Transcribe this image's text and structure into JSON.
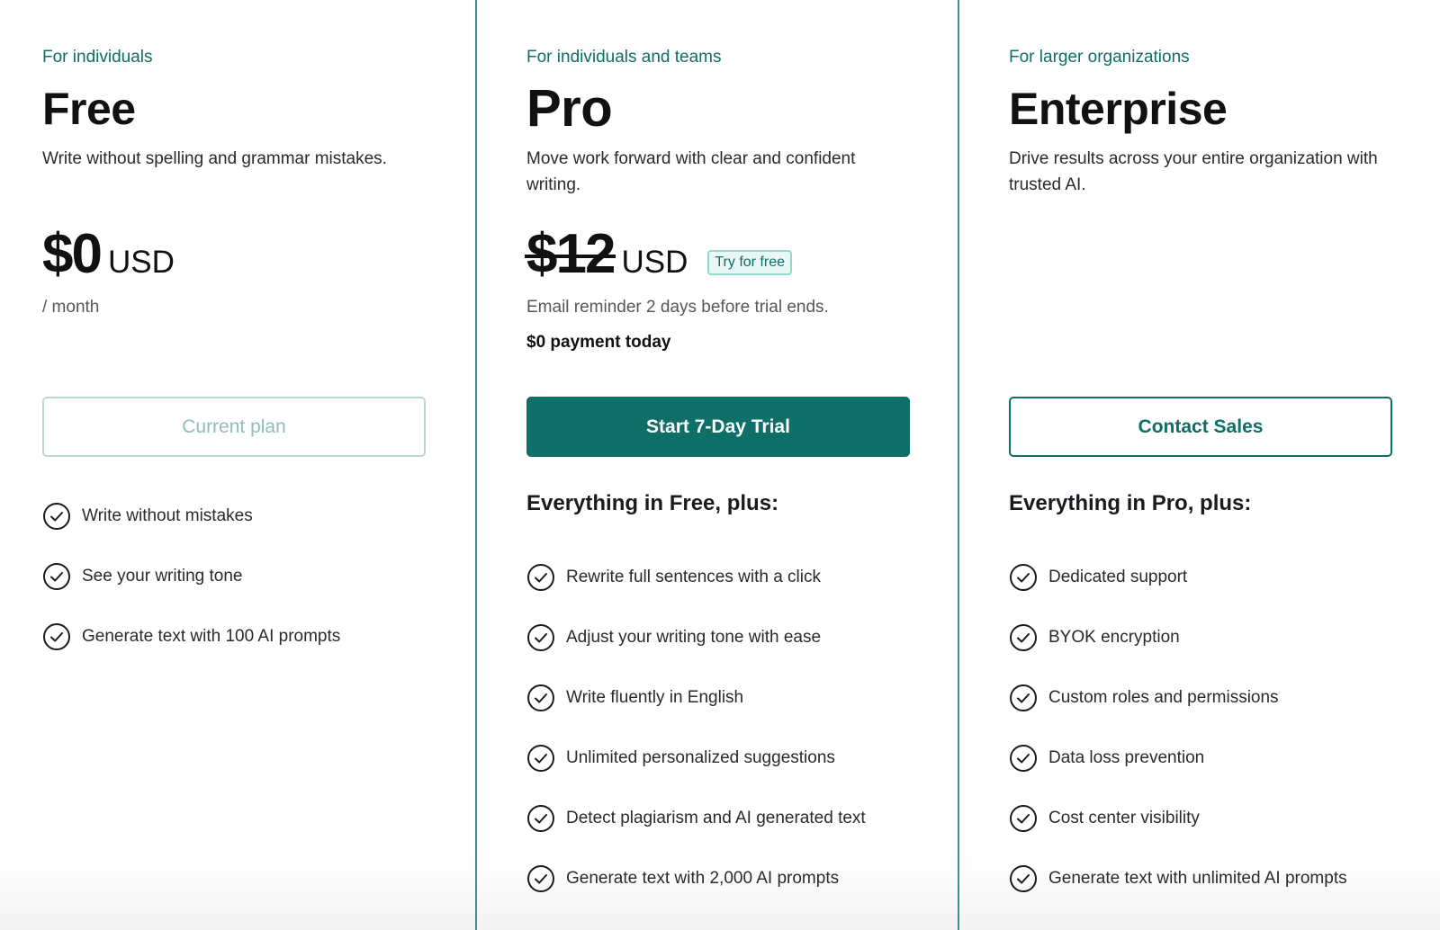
{
  "plans": {
    "free": {
      "eyebrow": "For individuals",
      "name": "Free",
      "description": "Write without spelling and grammar mistakes.",
      "price": "$0",
      "currency": "USD",
      "period": "/ month",
      "button_label": "Current plan",
      "features": [
        "Write without mistakes",
        "See your writing tone",
        "Generate text with 100 AI prompts"
      ]
    },
    "pro": {
      "eyebrow": "For individuals and teams",
      "name": "Pro",
      "description": "Move work forward with clear and confident writing.",
      "price": "$12",
      "currency": "USD",
      "badge": "Try for free",
      "reminder": "Email reminder 2 days before trial ends.",
      "payment_note": "$0 payment today",
      "button_label": "Start 7-Day Trial",
      "features_heading": "Everything in Free, plus:",
      "features": [
        "Rewrite full sentences with a click",
        "Adjust your writing tone with ease",
        "Write fluently in English",
        "Unlimited personalized suggestions",
        "Detect plagiarism and AI generated text",
        "Generate text with 2,000 AI prompts"
      ]
    },
    "enterprise": {
      "eyebrow": "For larger organizations",
      "name": "Enterprise",
      "description": "Drive results across your entire organization with trusted AI.",
      "button_label": "Contact Sales",
      "features_heading": "Everything in Pro, plus:",
      "features": [
        "Dedicated support",
        "BYOK encryption",
        "Custom roles and permissions",
        "Data loss prevention",
        "Cost center visibility",
        "Generate text with unlimited AI prompts"
      ]
    }
  },
  "colors": {
    "accent": "#0e6e68",
    "pro_border": "#3f8f88",
    "badge_bg": "#e9f8f5"
  },
  "icons": {
    "feature": "check-circle-icon"
  }
}
